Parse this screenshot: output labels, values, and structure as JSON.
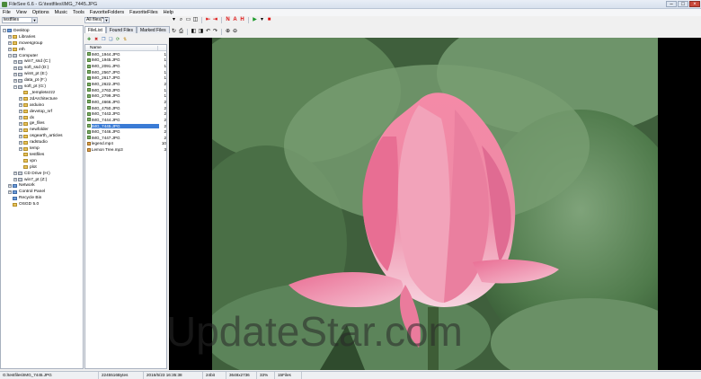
{
  "window": {
    "title": "FileSee 6.6 - G:\\testfiles\\IMG_7445.JPG",
    "controls": [
      "–",
      "□",
      "×"
    ]
  },
  "menubar": [
    "File",
    "View",
    "Options",
    "Music",
    "Tools",
    "FavoriteFolders",
    "FavoriteFiles",
    "Help"
  ],
  "path_combo": {
    "value": "testfiles"
  },
  "filter_combo": {
    "value": "All files(*.*)"
  },
  "tabs": [
    "FileList",
    "Found Files",
    "Marked Files"
  ],
  "tree": [
    {
      "label": "Desktop",
      "level": 0,
      "exp": "−",
      "icon": "blue"
    },
    {
      "label": "Libraries",
      "level": 1,
      "exp": "+",
      "icon": "folder"
    },
    {
      "label": "movesgroup",
      "level": 1,
      "exp": "+",
      "icon": "folder"
    },
    {
      "label": "eth",
      "level": 1,
      "exp": "+",
      "icon": "folder"
    },
    {
      "label": "Computer",
      "level": 1,
      "exp": "−",
      "icon": "drive"
    },
    {
      "label": "win7_ssd (C:)",
      "level": 2,
      "exp": "+",
      "icon": "drive"
    },
    {
      "label": "soft_ssd (D:)",
      "level": 2,
      "exp": "+",
      "icon": "drive"
    },
    {
      "label": "win8_pt (E:)",
      "level": 2,
      "exp": "+",
      "icon": "drive"
    },
    {
      "label": "data_pt (F:)",
      "level": 2,
      "exp": "+",
      "icon": "drive"
    },
    {
      "label": "soft_pt (G:)",
      "level": 2,
      "exp": "−",
      "icon": "drive"
    },
    {
      "label": "_templetezzz",
      "level": 3,
      "exp": "",
      "icon": "folder"
    },
    {
      "label": "2dArchitecture",
      "level": 3,
      "exp": "+",
      "icon": "folder"
    },
    {
      "label": "arduino",
      "level": 3,
      "exp": "+",
      "icon": "folder"
    },
    {
      "label": "devvtop_nrf",
      "level": 3,
      "exp": "+",
      "icon": "folder"
    },
    {
      "label": "dx",
      "level": 3,
      "exp": "+",
      "icon": "folder"
    },
    {
      "label": "ge_files",
      "level": 3,
      "exp": "+",
      "icon": "folder"
    },
    {
      "label": "newfolder",
      "level": 3,
      "exp": "+",
      "icon": "folder"
    },
    {
      "label": "osgearth_articles",
      "level": 3,
      "exp": "+",
      "icon": "folder"
    },
    {
      "label": "radstudio",
      "level": 3,
      "exp": "+",
      "icon": "folder"
    },
    {
      "label": "temp",
      "level": 3,
      "exp": "+",
      "icon": "folder"
    },
    {
      "label": "testfiles",
      "level": 3,
      "exp": "",
      "icon": "folder"
    },
    {
      "label": "vpn",
      "level": 3,
      "exp": "",
      "icon": "folder"
    },
    {
      "label": "plot",
      "level": 3,
      "exp": "",
      "icon": "folder"
    },
    {
      "label": "CD Drive (H:)",
      "level": 2,
      "exp": "+",
      "icon": "drive"
    },
    {
      "label": "win7_pt (Z:)",
      "level": 2,
      "exp": "+",
      "icon": "drive"
    },
    {
      "label": "Network",
      "level": 1,
      "exp": "+",
      "icon": "blue"
    },
    {
      "label": "Control Panel",
      "level": 1,
      "exp": "+",
      "icon": "blue"
    },
    {
      "label": "Recycle Bin",
      "level": 1,
      "exp": "",
      "icon": "blue"
    },
    {
      "label": "OSGD 5.0",
      "level": 1,
      "exp": "",
      "icon": "folder"
    }
  ],
  "filelist": {
    "column_header": "Name",
    "rows": [
      {
        "name": "IMG_1944.JPG",
        "count": "1",
        "type": "img"
      },
      {
        "name": "IMG_1945.JPG",
        "count": "1",
        "type": "img"
      },
      {
        "name": "IMG_2091.JPG",
        "count": "1",
        "type": "img"
      },
      {
        "name": "IMG_2567.JPG",
        "count": "1",
        "type": "img"
      },
      {
        "name": "IMG_2617.JPG",
        "count": "1",
        "type": "img"
      },
      {
        "name": "IMG_2622.JPG",
        "count": "2",
        "type": "img"
      },
      {
        "name": "IMG_2763.JPG",
        "count": "1",
        "type": "img"
      },
      {
        "name": "IMG_2799.JPG",
        "count": "1",
        "type": "img"
      },
      {
        "name": "IMG_4666.JPG",
        "count": "2",
        "type": "img"
      },
      {
        "name": "IMG_4750.JPG",
        "count": "2",
        "type": "img"
      },
      {
        "name": "IMG_7443.JPG",
        "count": "2",
        "type": "img"
      },
      {
        "name": "IMG_7444.JPG",
        "count": "2",
        "type": "img"
      },
      {
        "name": "IMG_7445.JPG",
        "count": "2",
        "type": "img",
        "selected": true
      },
      {
        "name": "IMG_7446.JPG",
        "count": "2",
        "type": "img"
      },
      {
        "name": "IMG_7447.JPG",
        "count": "2",
        "type": "img"
      },
      {
        "name": "legend.mp4",
        "count": "10",
        "type": "music"
      },
      {
        "name": "Lemon Tree.mp3",
        "count": "3",
        "type": "music"
      }
    ]
  },
  "file_toolbar_icons": [
    "folder-new-icon",
    "delete-icon",
    "copy-icon",
    "move-icon",
    "refresh-icon",
    "sort-icon"
  ],
  "viewer_toolbar1": [
    {
      "name": "combo-small-icon",
      "glyph": "▾"
    },
    {
      "name": "search-icon",
      "glyph": "⌕"
    },
    {
      "name": "folder-icon",
      "glyph": "▭"
    },
    {
      "name": "zoom-icon",
      "glyph": "◫"
    },
    {
      "name": "sep"
    },
    {
      "name": "prev-icon",
      "glyph": "⇤",
      "cls": "red"
    },
    {
      "name": "next-icon",
      "glyph": "⇥",
      "cls": "red"
    },
    {
      "name": "sep"
    },
    {
      "name": "n-icon",
      "glyph": "N",
      "cls": "red"
    },
    {
      "name": "a-icon",
      "glyph": "A",
      "cls": "red"
    },
    {
      "name": "h-icon",
      "glyph": "H",
      "cls": "red"
    },
    {
      "name": "sep"
    },
    {
      "name": "play-icon",
      "glyph": "▶",
      "cls": "green"
    },
    {
      "name": "play-down-icon",
      "glyph": "▾"
    },
    {
      "name": "stop-icon",
      "glyph": "■",
      "cls": "red"
    }
  ],
  "viewer_toolbar2": [
    {
      "name": "rotate-icon",
      "glyph": "↻"
    },
    {
      "name": "print-icon",
      "glyph": "⎙"
    },
    {
      "name": "sep"
    },
    {
      "name": "fit-icon",
      "glyph": "◧"
    },
    {
      "name": "flip-icon",
      "glyph": "◨"
    },
    {
      "name": "rotate-left-icon",
      "glyph": "↶"
    },
    {
      "name": "rotate-right-icon",
      "glyph": "↷"
    },
    {
      "name": "sep"
    },
    {
      "name": "zoom-in-icon",
      "glyph": "⊕"
    },
    {
      "name": "zoom-out-icon",
      "glyph": "⊖"
    }
  ],
  "watermark": "UpdateStar.com",
  "statusbar": [
    "G:\\testfiles\\IMG_7445.JPG",
    "2245516Bytes",
    "2016/5/23 16:35:38",
    "24bit",
    "3648x2736",
    "33%",
    "15Files"
  ]
}
